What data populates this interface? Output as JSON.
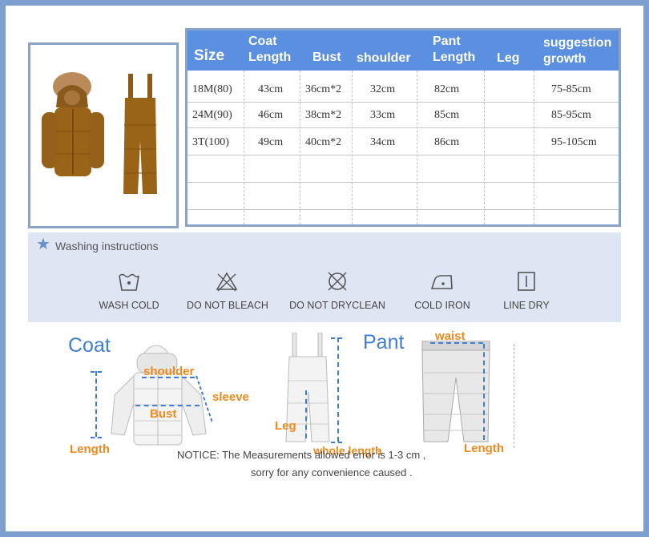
{
  "table": {
    "headers": {
      "size": "Size",
      "coat_length": [
        "Coat",
        "Length"
      ],
      "bust": "Bust",
      "shoulder": "shoulder",
      "pant_length": [
        "Pant",
        "Length"
      ],
      "leg": "Leg",
      "suggestion_growth": [
        "suggestion",
        "growth"
      ]
    },
    "rows": [
      {
        "size": "18M(80)",
        "coat_length": "43cm",
        "bust": "36cm*2",
        "shoulder": "32cm",
        "pant_length": "82cm",
        "leg": "",
        "growth": "75-85cm"
      },
      {
        "size": "24M(90)",
        "coat_length": "46cm",
        "bust": "38cm*2",
        "shoulder": "33cm",
        "pant_length": "85cm",
        "leg": "",
        "growth": "85-95cm"
      },
      {
        "size": "3T(100)",
        "coat_length": "49cm",
        "bust": "40cm*2",
        "shoulder": "34cm",
        "pant_length": "86cm",
        "leg": "",
        "growth": "95-105cm"
      }
    ]
  },
  "washing": {
    "title": "Washing instructions",
    "items": [
      {
        "icon": "wash-cold-icon",
        "label": "WASH COLD"
      },
      {
        "icon": "do-not-bleach-icon",
        "label": "DO NOT BLEACH"
      },
      {
        "icon": "do-not-dryclean-icon",
        "label": "DO NOT DRYCLEAN"
      },
      {
        "icon": "cold-iron-icon",
        "label": "COLD IRON"
      },
      {
        "icon": "line-dry-icon",
        "label": "LINE DRY"
      }
    ]
  },
  "measurement": {
    "coat_title": "Coat",
    "pant_title": "Pant",
    "shoulder": "shoulder",
    "sleeve": "sleeve",
    "bust": "Bust",
    "coat_length": "Length",
    "leg": "Leg",
    "whole_length": "whole length",
    "waist": "waist",
    "pant_length": "Length"
  },
  "notice": {
    "line1": "NOTICE:   The Measurements allowed error is 1-3 cm ,",
    "line2": "sorry for any convenience caused ."
  },
  "colors": {
    "header_bg": "#5b8fe0",
    "accent_orange": "#f08a1c",
    "accent_blue": "#3f7ed6",
    "frame": "#7d9fcf"
  }
}
